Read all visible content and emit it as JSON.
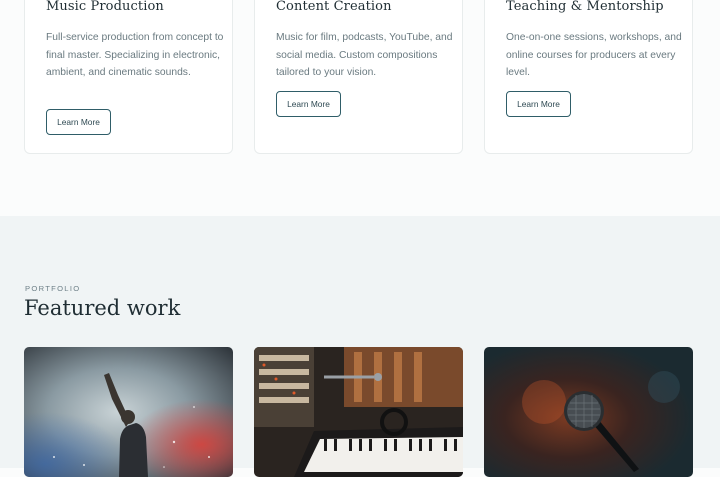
{
  "services": [
    {
      "title": "Music Production",
      "description": "Full-service production from concept to final master. Specializing in electronic, ambient, and cinematic sounds.",
      "button_label": "Learn More"
    },
    {
      "title": "Content Creation",
      "description": "Music for film, podcasts, YouTube, and social media. Custom compositions tailored to your vision.",
      "button_label": "Learn More"
    },
    {
      "title": "Teaching & Mentorship",
      "description": "One-on-one sessions, workshops, and online courses for producers at every level.",
      "button_label": "Learn More"
    }
  ],
  "portfolio": {
    "eyebrow": "PORTFOLIO",
    "heading": "Featured work",
    "items": [
      {
        "image": "concert-performer-photo"
      },
      {
        "image": "studio-keyboard-photo"
      },
      {
        "image": "microphone-photo"
      }
    ]
  },
  "colors": {
    "accent": "#2f5d68",
    "section_bg": "#f0f4f5",
    "card_border": "#e8ecec"
  }
}
